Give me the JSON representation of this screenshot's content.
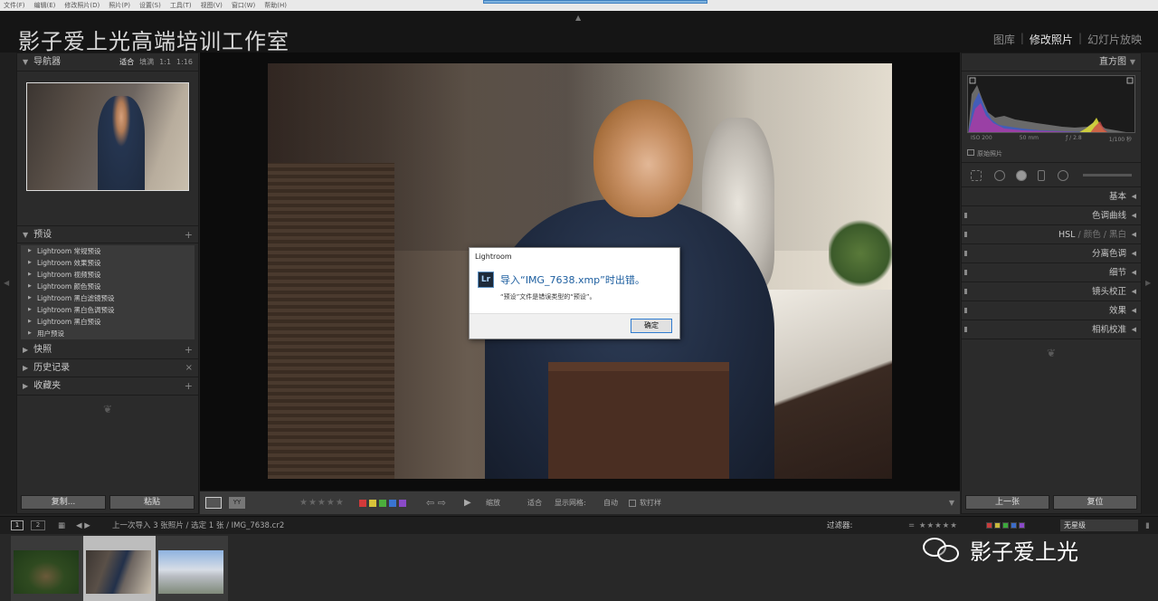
{
  "menubar": {
    "items": [
      "文件(F)",
      "编辑(E)",
      "修改照片(D)",
      "照片(P)",
      "设置(S)",
      "工具(T)",
      "视图(V)",
      "窗口(W)",
      "帮助(H)"
    ]
  },
  "header": {
    "studio_name": "影子爱上光高端培训工作室",
    "modules": [
      "图库",
      "修改照片",
      "幻灯片放映"
    ],
    "separator": "|"
  },
  "navigator": {
    "title": "导航器",
    "options": [
      "适合",
      "填满",
      "1:1",
      "1:16"
    ]
  },
  "presets": {
    "title": "预设",
    "items": [
      "Lightroom 常规预设",
      "Lightroom 效果预设",
      "Lightroom 视频预设",
      "Lightroom 颜色预设",
      "Lightroom 黑白滤镜预设",
      "Lightroom 黑白色调预设",
      "Lightroom 黑白预设",
      "用户预设"
    ]
  },
  "left_sections": {
    "snapshots": "快照",
    "history": "历史记录",
    "collections": "收藏夹"
  },
  "left_buttons": {
    "copy": "复制...",
    "paste": "粘贴"
  },
  "dialog": {
    "title": "Lightroom",
    "icon_text": "Lr",
    "message": "导入“IMG_7638.xmp”时出错。",
    "detail": "“预设”文件是错误类型的“预设”。",
    "ok_button": "确定"
  },
  "toolbar": {
    "yy": "YY",
    "stars": "★★★★★",
    "color_labels": [
      "#d23a3a",
      "#d8c43a",
      "#4cae3c",
      "#3a74d0",
      "#8a4ac8"
    ],
    "zoom_label": "缩放",
    "zoom_value": "适合",
    "grid_label": "显示网格:",
    "grid_value": "自动",
    "softproof_label": "软打样"
  },
  "filmbar": {
    "view1": "1",
    "view2": "2",
    "breadcrumb": "上一次导入  3 张照片 / 选定 1 张 / IMG_7638.cr2",
    "filter_label": "过滤器:",
    "filter_stars": "= ★★★★★",
    "filter_colors": [
      "#c83c3c",
      "#c8b83c",
      "#3ca83c",
      "#3c6cc8",
      "#8a4ac8"
    ],
    "filter_select": "无星级"
  },
  "histogram": {
    "title": "直方图",
    "iso": "ISO 200",
    "focal": "50 mm",
    "aperture": "ƒ / 2.8",
    "shutter": "1/100 秒",
    "original_photo_label": "原始照片"
  },
  "right_sections": [
    "基本",
    "色调曲线",
    "分离色调",
    "细节",
    "镜头校正",
    "效果",
    "相机校准"
  ],
  "hsl": {
    "hsl": "HSL",
    "sep": "/",
    "color": "颜色",
    "bw": "黑白"
  },
  "right_buttons": {
    "previous": "上一张",
    "reset": "复位"
  },
  "watermark": {
    "name": "影子爱上光"
  }
}
